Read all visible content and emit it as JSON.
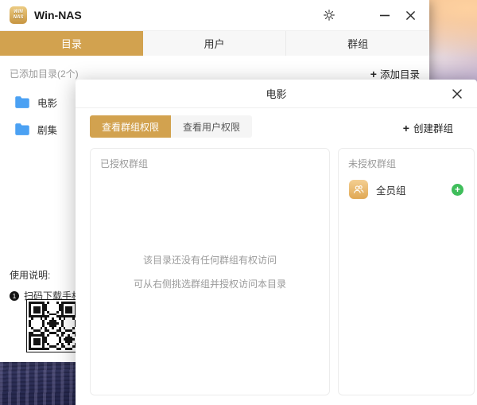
{
  "window": {
    "title": "Win-NAS",
    "logo": {
      "line1": "WIN",
      "line2": "NAS"
    },
    "tabs": [
      {
        "label": "目录",
        "active": true
      },
      {
        "label": "用户",
        "active": false
      },
      {
        "label": "群组",
        "active": false
      }
    ],
    "directory_header": {
      "count_label": "已添加目录(2个)",
      "add_icon": "+",
      "add_label": "添加目录"
    },
    "directories": [
      {
        "name": "电影"
      },
      {
        "name": "剧集"
      }
    ],
    "usage": {
      "title": "使用说明:",
      "step_number": "1",
      "step_text": "扫码下载手机"
    }
  },
  "dialog": {
    "title": "电影",
    "tabs": [
      {
        "label": "查看群组权限",
        "active": true
      },
      {
        "label": "查看用户权限",
        "active": false
      }
    ],
    "create_group": {
      "icon": "+",
      "label": "创建群组"
    },
    "authorized_panel": {
      "title": "已授权群组",
      "empty_line1": "该目录还没有任何群组有权访问",
      "empty_line2": "可从右侧挑选群组并授权访问本目录"
    },
    "unauthorized_panel": {
      "title": "未授权群组",
      "add_icon": "+",
      "groups": [
        {
          "name": "全员组"
        }
      ]
    }
  },
  "colors": {
    "accent_gold": "#D2A24F",
    "folder_blue": "#4BA1F3",
    "add_green": "#3FBE5B"
  }
}
